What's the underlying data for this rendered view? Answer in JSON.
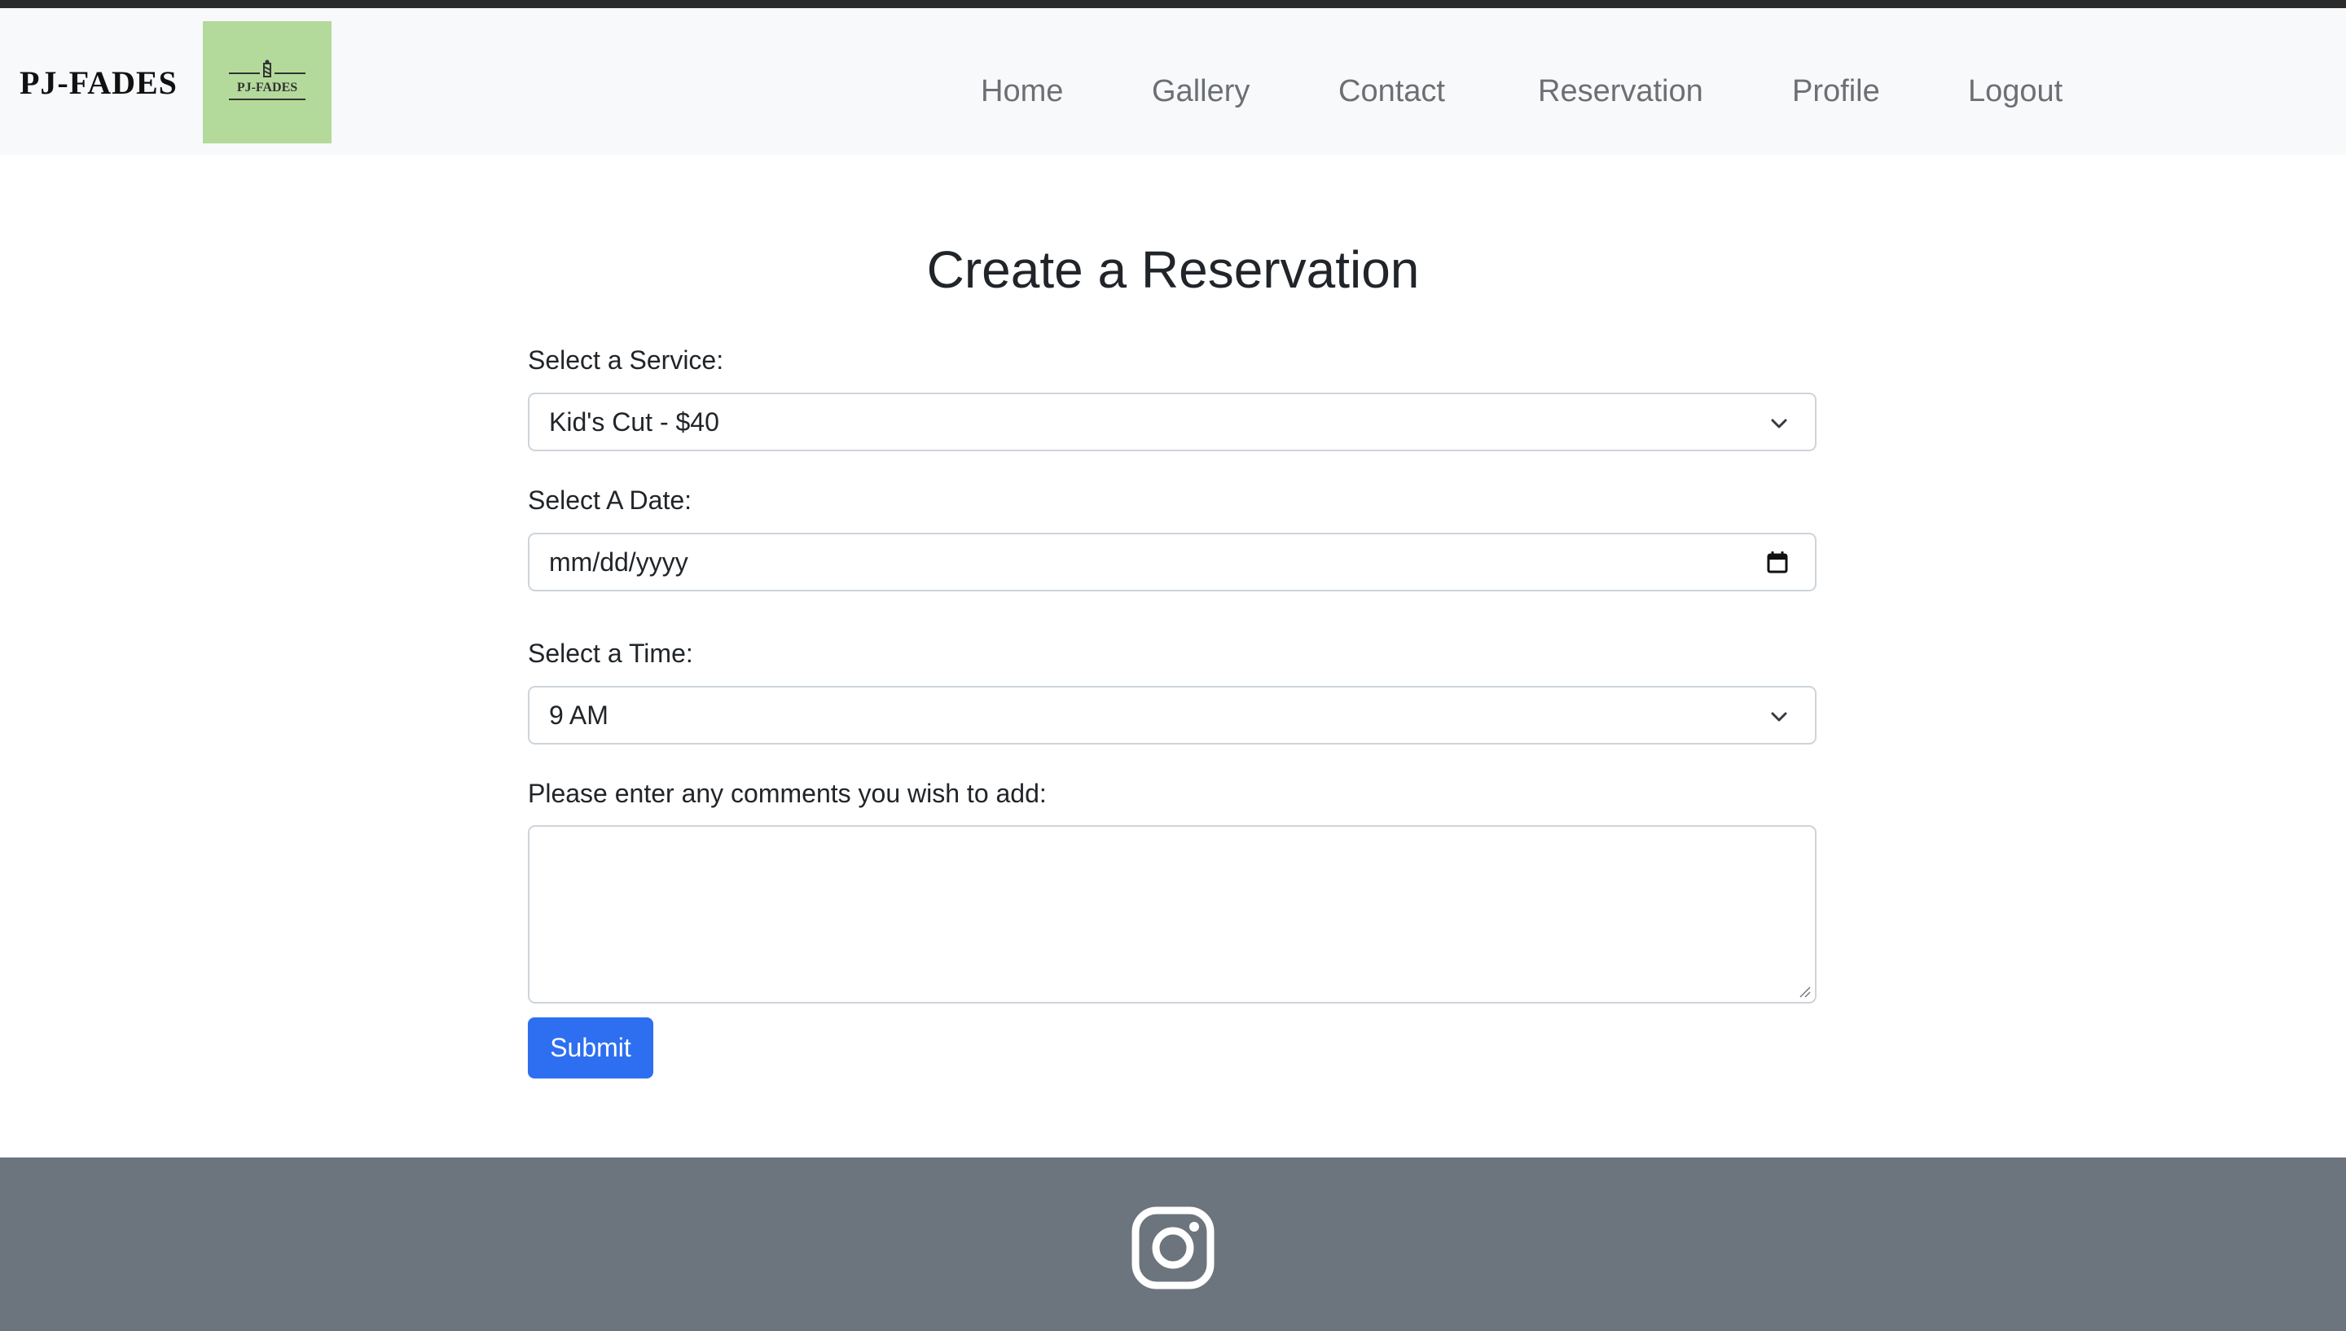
{
  "brand": {
    "name": "PJ-FADES",
    "logo_text": "PJ-FADES",
    "logo_bg_color": "#b3da9b"
  },
  "nav": {
    "items": [
      {
        "label": "Home"
      },
      {
        "label": "Gallery"
      },
      {
        "label": "Contact"
      },
      {
        "label": "Reservation"
      },
      {
        "label": "Profile"
      },
      {
        "label": "Logout"
      }
    ]
  },
  "form": {
    "title": "Create a Reservation",
    "service_label": "Select a Service:",
    "service_value": "Kid's Cut - $40",
    "date_label": "Select A Date:",
    "date_placeholder": "mm/dd/yyyy",
    "time_label": "Select a Time:",
    "time_value": "9 AM",
    "comments_label": "Please enter any comments you wish to add:",
    "comments_value": "",
    "submit_label": "Submit",
    "submit_color": "#2d6ff0"
  },
  "footer": {
    "bg_color": "#6c757d",
    "icon": "instagram-icon"
  }
}
